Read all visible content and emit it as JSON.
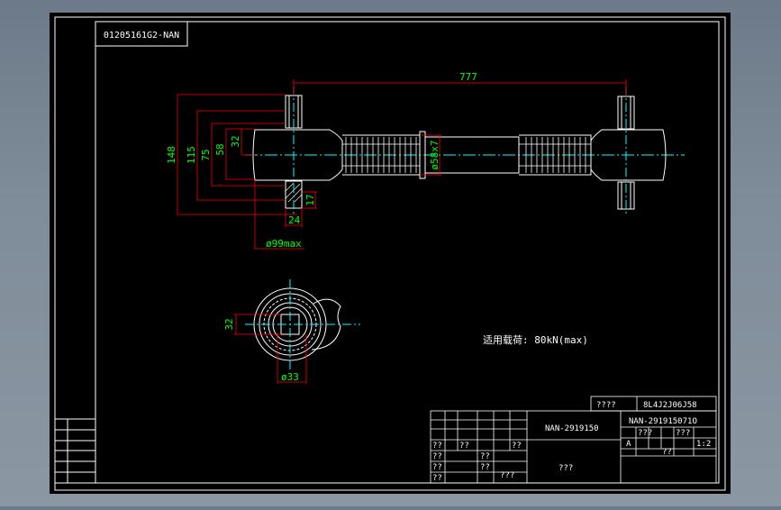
{
  "drawing": {
    "corner_code": "01205161G2-NAN",
    "dimensions": {
      "length": "777",
      "d148": "148",
      "d115": "115",
      "d75": "75",
      "d58": "58",
      "d32_top": "32",
      "d17": "17",
      "d24": "24",
      "d99": "ø99max",
      "d58x7": "ø58x7",
      "d32_side": "32",
      "d33": "ø33"
    },
    "note": "适用载荷: 80kN(max)",
    "title_block": {
      "marks": "????",
      "doc_code": "8L4J2J06J58",
      "part_name": "NAN-2919150",
      "drawing_no": "NAN-291915071O",
      "center_label": "???",
      "letter_a": "A",
      "scale": "1:2",
      "q2": "??",
      "q3": "???"
    }
  },
  "colors": {
    "background": "#000000",
    "frame": "#ffffff",
    "dimension": "#ff0000",
    "dim_text": "#00ff00",
    "centerline": "#00ffff"
  }
}
